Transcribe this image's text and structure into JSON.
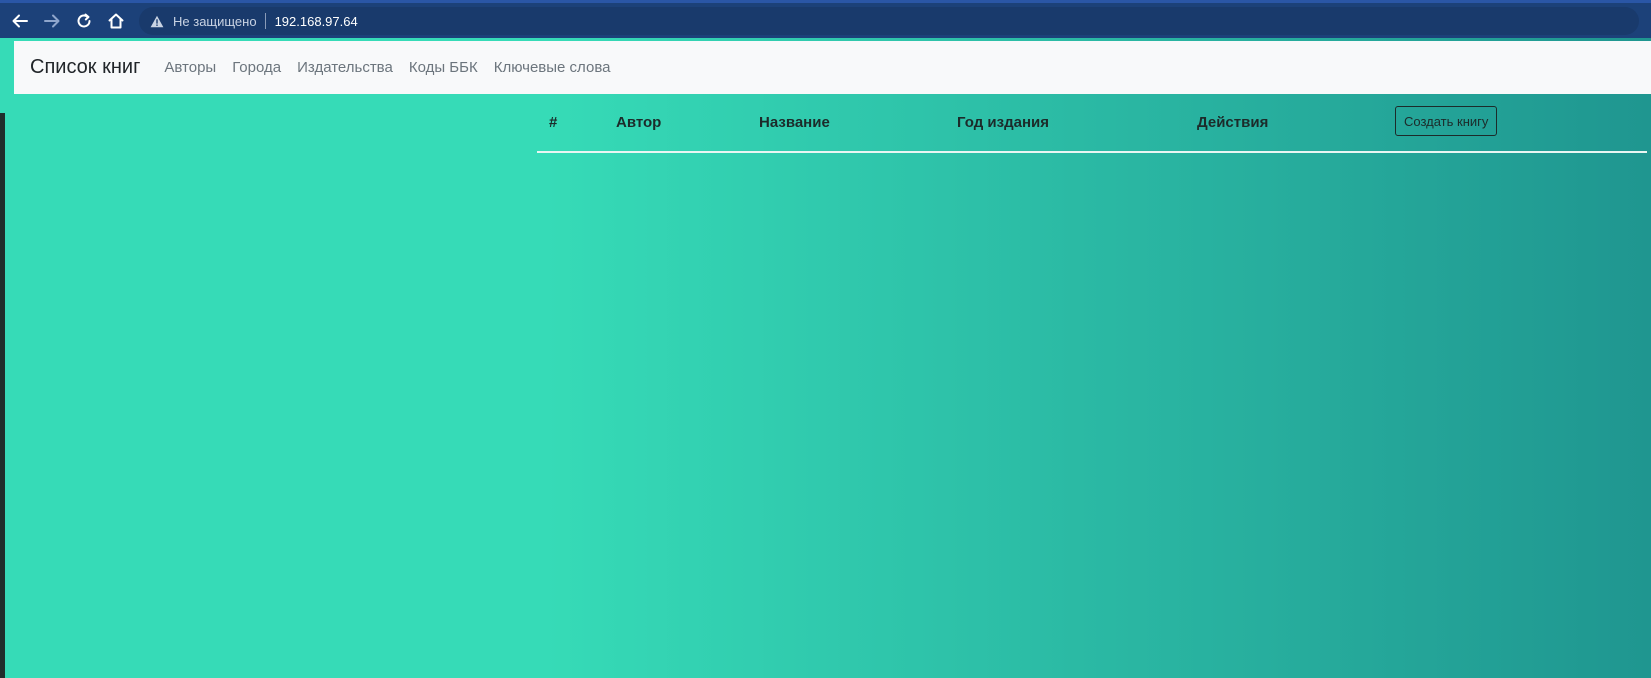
{
  "browser": {
    "security_label": "Не защищено",
    "url": "192.168.97.64",
    "colors": {
      "toolbar": "#1c4179",
      "address_bar": "#193a6c"
    },
    "icons": [
      "back-arrow-icon",
      "forward-arrow-icon",
      "reload-icon",
      "home-icon",
      "warning-icon"
    ]
  },
  "navbar": {
    "brand": "Список книг",
    "links": [
      "Авторы",
      "Города",
      "Издательства",
      "Коды ББК",
      "Ключевые слова"
    ]
  },
  "table": {
    "headers": [
      "#",
      "Автор",
      "Название",
      "Год издания",
      "Действия"
    ],
    "rows": []
  },
  "actions": {
    "create_label": "Создать книгу"
  },
  "theme": {
    "gradient_start": "#36dbb7",
    "gradient_end": "#1f9690",
    "navbar_bg": "#f8f9fa"
  }
}
